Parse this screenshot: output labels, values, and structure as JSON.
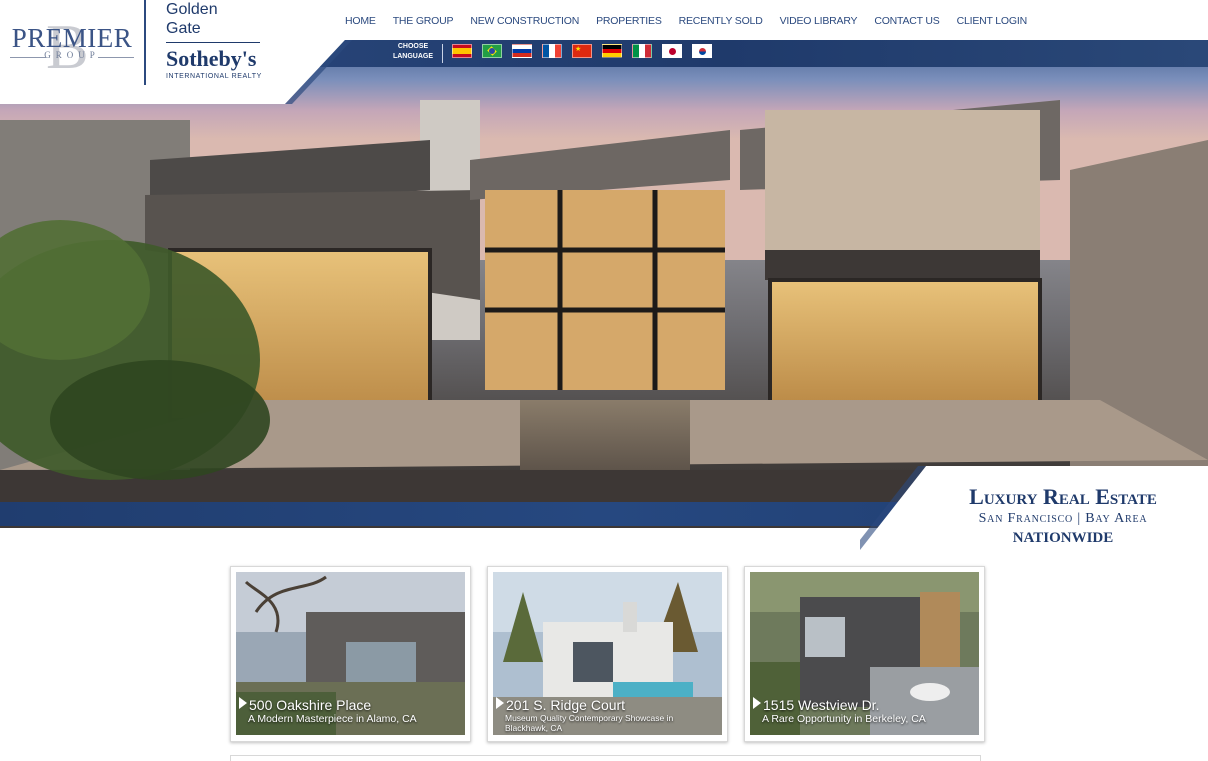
{
  "brand": {
    "premier_word": "PREMIER",
    "premier_sub": "GROUP",
    "premier_mark": "B",
    "partner_line1": "Golden",
    "partner_line2": "Gate",
    "partner_name": "Sotheby's",
    "partner_sub": "INTERNATIONAL REALTY"
  },
  "nav": {
    "items": [
      "HOME",
      "THE GROUP",
      "NEW CONSTRUCTION",
      "PROPERTIES",
      "RECENTLY SOLD",
      "VIDEO LIBRARY",
      "CONTACT US",
      "CLIENT LOGIN"
    ]
  },
  "language": {
    "label_line1": "CHOOSE",
    "label_line2": "LANGUAGE",
    "flags": [
      "spain-flag-icon",
      "brazil-flag-icon",
      "russia-flag-icon",
      "france-flag-icon",
      "china-flag-icon",
      "germany-flag-icon",
      "italy-flag-icon",
      "japan-flag-icon",
      "korea-flag-icon"
    ]
  },
  "hero": {
    "tagline_title": "Luxury Real Estate",
    "tagline_sub": "San Francisco | Bay Area",
    "tagline_bottom": "NATIONWIDE"
  },
  "properties": [
    {
      "address": "500 Oakshire Place",
      "description": "A Modern Masterpiece in Alamo, CA"
    },
    {
      "address": "201 S. Ridge Court",
      "description": "Museum Quality Contemporary Showcase in Blackhawk, CA"
    },
    {
      "address": "1515 Westview Dr.",
      "description": "A Rare Opportunity in Berkeley, CA"
    }
  ],
  "colors": {
    "brand_navy": "#1f3a6b",
    "nav_text": "#2c4a7f"
  }
}
